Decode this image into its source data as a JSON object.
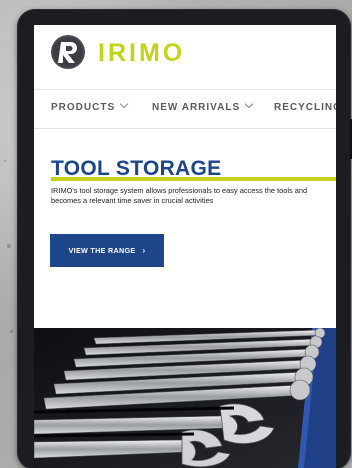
{
  "brand": {
    "name": "IRIMO",
    "logo_icon": "irimo-r-logo-icon"
  },
  "nav": {
    "items": [
      {
        "label": "PRODUCTS",
        "has_dropdown": true
      },
      {
        "label": "NEW ARRIVALS",
        "has_dropdown": true
      },
      {
        "label": "RECYCLING",
        "has_dropdown": false
      }
    ]
  },
  "hero": {
    "title": "TOOL STORAGE",
    "description": "IRIMO's tool storage system allows professionals to easy access the tools and becomes a relevant time saver in crucial activities",
    "cta_label": "VIEW THE RANGE",
    "cta_arrow": "›"
  },
  "colors": {
    "brand_lime": "#c3d31c",
    "brand_blue": "#1d4587",
    "device_frame": "#1c1d20",
    "tool_drawer_blue": "#1f3f86"
  }
}
